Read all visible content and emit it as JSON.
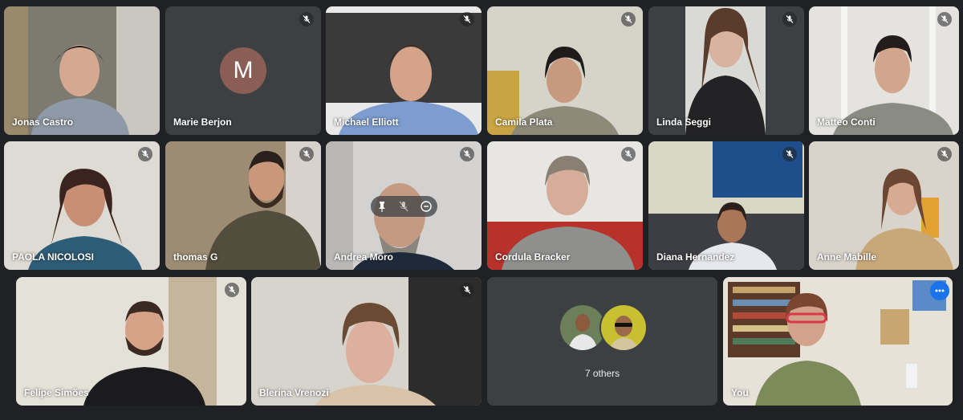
{
  "participants": [
    {
      "name": "Jonas Castro",
      "muted": false
    },
    {
      "name": "Marie Berjon",
      "muted": true,
      "avatar_letter": "M"
    },
    {
      "name": "Michael Elliott",
      "muted": true
    },
    {
      "name": "Camila Plata",
      "muted": true
    },
    {
      "name": "Linda Seggi",
      "muted": true
    },
    {
      "name": "Matteo Conti",
      "muted": true
    },
    {
      "name": "PAOLA NICOLOSI",
      "muted": true
    },
    {
      "name": "thomas G",
      "muted": true
    },
    {
      "name": "Andrea Moro",
      "muted": true
    },
    {
      "name": "Cordula Bracker",
      "muted": true
    },
    {
      "name": "Diana Hernandez",
      "muted": true
    },
    {
      "name": "Anne Mabille",
      "muted": true
    },
    {
      "name": "Felipe Simões",
      "muted": true
    },
    {
      "name": "Blerina Vrenozi",
      "muted": true
    },
    {
      "name": "You",
      "muted": false
    }
  ],
  "others_label": "7 others",
  "colors": {
    "background": "#202124",
    "tile": "#3c4043",
    "selected_outline": "#8ab4f8",
    "accent": "#1a73e8"
  },
  "icons": [
    "mic-off-icon",
    "pin-icon",
    "mute-icon",
    "remove-icon",
    "more-options-icon"
  ]
}
